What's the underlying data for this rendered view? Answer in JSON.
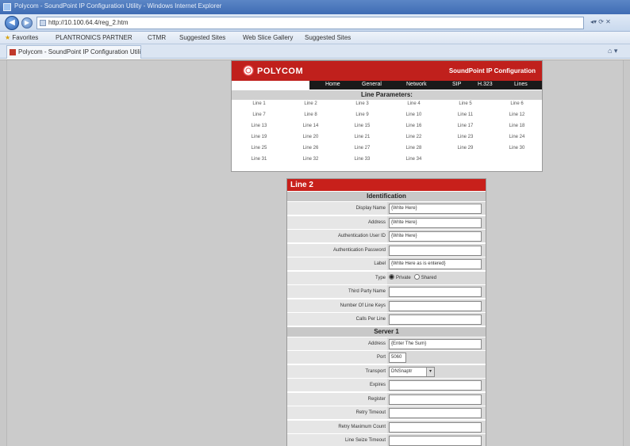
{
  "browser": {
    "window_title": "Polycom - SoundPoint IP Configuration Utility - Windows Internet Explorer",
    "url": "http://10.100.64.4/reg_2.htm",
    "favorites_label": "Favorites",
    "favorites": [
      "PLANTRONICS PARTNER",
      "CTMR",
      "Suggested Sites",
      "Web Slice Gallery",
      "Suggested Sites"
    ],
    "tab_title": "Polycom - SoundPoint IP Configuration Utility"
  },
  "header": {
    "logo": "POLYCOM",
    "title": "SoundPoint IP Configuration",
    "nav": [
      "Home",
      "General",
      "Network",
      "SIP",
      "H.323",
      "Lines"
    ],
    "line_parameters_title": "Line Parameters:",
    "lines": [
      [
        "Line 1",
        "Line 2",
        "Line 3",
        "Line 4",
        "Line 5",
        "Line 6"
      ],
      [
        "Line 7",
        "Line 8",
        "Line 9",
        "Line 10",
        "Line 11",
        "Line 12"
      ],
      [
        "Line 13",
        "Line 14",
        "Line 15",
        "Line 16",
        "Line 17",
        "Line 18"
      ],
      [
        "Line 19",
        "Line 20",
        "Line 21",
        "Line 22",
        "Line 23",
        "Line 24"
      ],
      [
        "Line 25",
        "Line 26",
        "Line 27",
        "Line 28",
        "Line 29",
        "Line 30"
      ],
      [
        "Line 31",
        "Line 32",
        "Line 33",
        "Line 34"
      ]
    ]
  },
  "form": {
    "title": "Line 2",
    "identification_title": "Identification",
    "identification_fields": [
      {
        "label": "Display Name",
        "value": "{Write Here}"
      },
      {
        "label": "Address",
        "value": "{Write Here}"
      },
      {
        "label": "Authentication User ID",
        "value": "{Write Here}"
      },
      {
        "label": "Authentication Password",
        "value": ""
      },
      {
        "label": "Label",
        "value": "{Write Here as is entered}"
      }
    ],
    "type_label": "Type",
    "type_options": [
      "Private",
      "Shared"
    ],
    "type_selected": "Private",
    "extra_fields": [
      {
        "label": "Third Party Name",
        "value": ""
      },
      {
        "label": "Number Of Line Keys",
        "value": ""
      },
      {
        "label": "Calls Per Line",
        "value": ""
      }
    ],
    "server_title": "Server 1",
    "server_fields": [
      {
        "label": "Address",
        "value": "{Enter The Sum}"
      },
      {
        "label": "Port",
        "value": "5060"
      },
      {
        "label": "Transport",
        "value": "DNSnaptr"
      },
      {
        "label": "Expires",
        "value": ""
      },
      {
        "label": "Register",
        "value": ""
      },
      {
        "label": "Retry Timeout",
        "value": ""
      },
      {
        "label": "Retry Maximum Count",
        "value": ""
      },
      {
        "label": "Line Seize Timeout",
        "value": ""
      }
    ]
  }
}
